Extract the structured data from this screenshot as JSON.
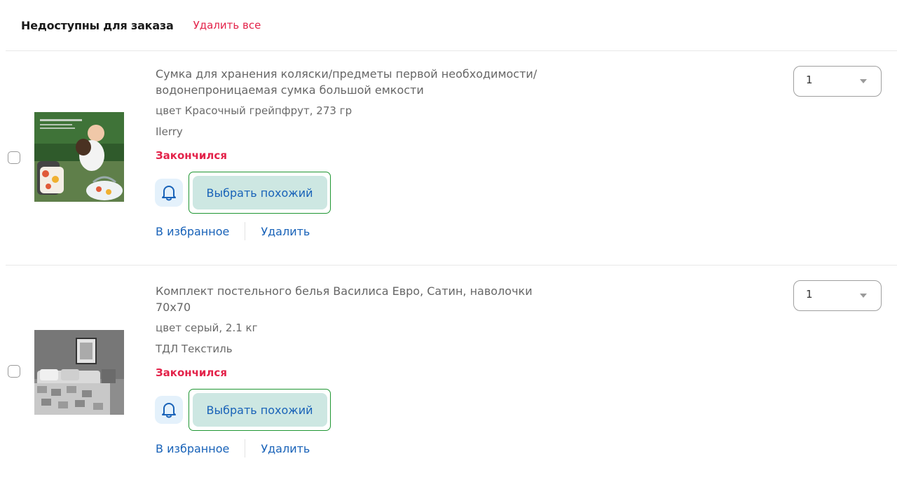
{
  "header": {
    "title": "Недоступны для заказа",
    "delete_all": "Удалить все"
  },
  "items": [
    {
      "title": "Сумка для хранения коляски/предметы первой необходимости/водонепроницаемая сумка большой емкости",
      "meta": "цвет Красочный грейпфрут, 273 гр",
      "brand": "Ilerry",
      "status": "Закончился",
      "similar_label": "Выбрать похожий",
      "favorite_label": "В избранное",
      "delete_label": "Удалить",
      "quantity": "1",
      "bell_icon": "bell-icon"
    },
    {
      "title": "Комплект постельного белья Василиса Евро, Сатин, наволочки 70х70",
      "meta": "цвет серый, 2.1 кг",
      "brand": "ТДЛ Текстиль",
      "status": "Закончился",
      "similar_label": "Выбрать похожий",
      "favorite_label": "В избранное",
      "delete_label": "Удалить",
      "quantity": "1",
      "bell_icon": "bell-icon"
    }
  ],
  "colors": {
    "accent_red": "#e3234a",
    "link_blue": "#1862b8",
    "highlight_green": "#1f9632",
    "similar_bg": "#cde7e2"
  }
}
